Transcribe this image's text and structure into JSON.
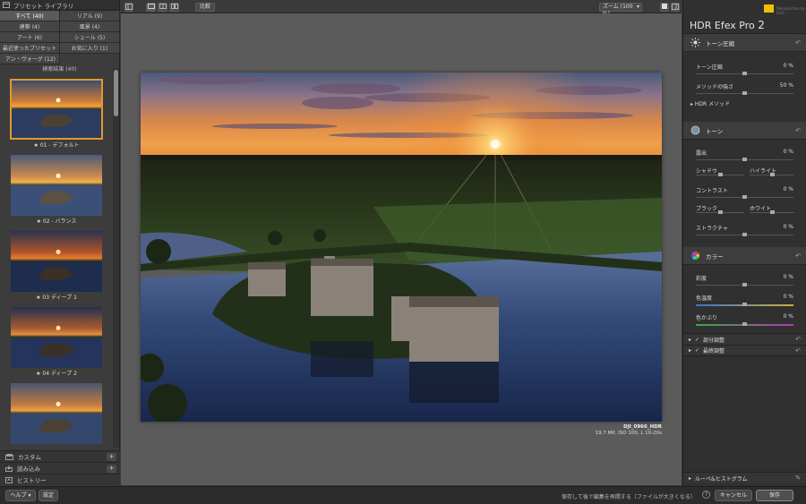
{
  "left_panel": {
    "header": "プリセット ライブラリ",
    "categories": [
      {
        "label": "すべて (40)",
        "selected": true
      },
      {
        "label": "リアル (9)",
        "selected": false
      },
      {
        "label": "建築 (4)",
        "selected": false
      },
      {
        "label": "風景 (4)",
        "selected": false
      },
      {
        "label": "アート (6)",
        "selected": false
      },
      {
        "label": "シュール (5)",
        "selected": false
      },
      {
        "label": "最近使ったプリセット",
        "selected": false
      },
      {
        "label": "お気に入り (1)",
        "selected": false
      },
      {
        "label": "アン・ヴォーグ (12)",
        "selected": false
      }
    ],
    "results_title": "検索結果 (40)",
    "thumbnails": [
      {
        "caption": "★ 01 - デフォルト",
        "selected": true
      },
      {
        "caption": "★ 02 - バランス",
        "selected": false
      },
      {
        "caption": "★ 03 ディープ 1",
        "selected": false
      },
      {
        "caption": "★ 04 ディープ 2",
        "selected": false
      },
      {
        "caption": "",
        "selected": false
      }
    ],
    "bottom_sections": {
      "custom": "カスタム",
      "import": "読み込み",
      "history": "ヒストリー"
    }
  },
  "toolbar": {
    "compare_label": "比較",
    "zoom_label": "ズーム (100 %)"
  },
  "image": {
    "filename": "DJI_0966_HDR",
    "info": "19.7 MP, ISO 100, L 10-20s"
  },
  "right_panel": {
    "title": "HDR Efex Pro",
    "version": "2",
    "brand_by": "Nikcollection by DxO",
    "tone_compression": {
      "header": "トーン圧縮",
      "controls": [
        {
          "label": "トーン圧縮",
          "value": "0 %",
          "level": 0.5
        },
        {
          "label": "メソッドの強さ",
          "value": "50 %",
          "level": 0.5
        }
      ],
      "hdr_method": "HDR メソッド"
    },
    "tone": {
      "header": "トーン",
      "exposure": {
        "label": "露出",
        "value": "0 %",
        "level": 0.5
      },
      "shadows": {
        "label": "シャドウ",
        "level": 0.5
      },
      "highlights": {
        "label": "ハイライト",
        "level": 0.5
      },
      "contrast": {
        "label": "コントラスト",
        "value": "0 %",
        "level": 0.5
      },
      "blacks": {
        "label": "ブラック",
        "level": 0.5
      },
      "whites": {
        "label": "ホワイト",
        "level": 0.5
      },
      "structure": {
        "label": "ストラクチャ",
        "value": "0 %",
        "level": 0.5
      }
    },
    "color": {
      "header": "カラー",
      "saturation": {
        "label": "彩度",
        "value": "0 %",
        "level": 0.5
      },
      "temperature": {
        "label": "色温度",
        "value": "0 %",
        "level": 0.5
      },
      "tint": {
        "label": "色かぶり",
        "value": "0 %",
        "level": 0.5
      }
    },
    "local_adjustments": "部分調整",
    "finishing": "最終調整",
    "loupe": "ルーペ&ヒストグラム"
  },
  "bottom_bar": {
    "help": "ヘルプ",
    "settings": "設定",
    "message": "保存して後で編集を再開する（ファイルが大きくなる）",
    "help_q": "?",
    "cancel": "キャンセル",
    "save": "保存"
  },
  "colors": {
    "selection_orange": "#e09a2a",
    "temperature_blue": "#3a73c9",
    "temperature_yellow": "#c9b23a",
    "tint_green": "#3aa84a",
    "tint_magenta": "#b03ab0",
    "brand_yellow": "#f0c000"
  }
}
